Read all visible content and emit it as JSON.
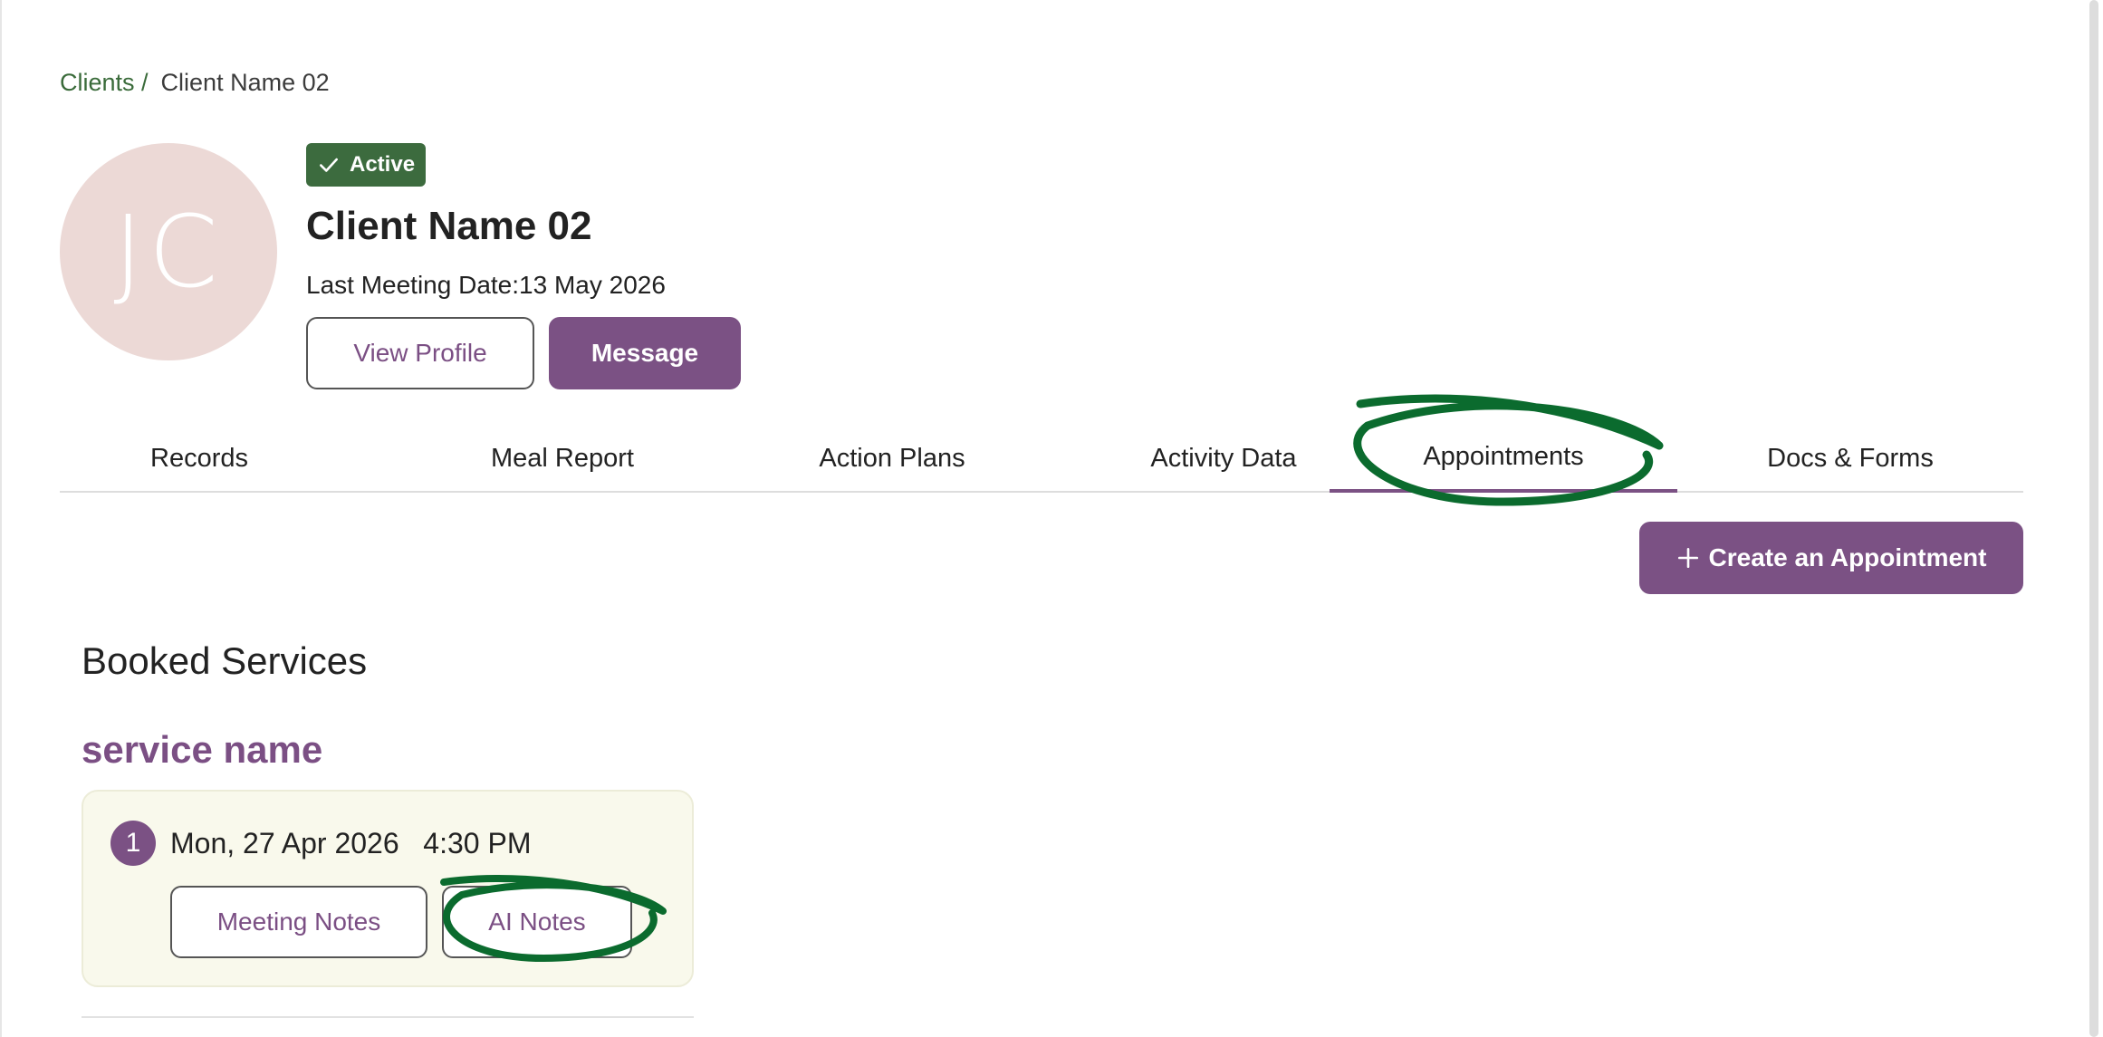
{
  "breadcrumb": {
    "parent": "Clients /",
    "current": "Client Name 02"
  },
  "client": {
    "initials": "JC",
    "status": "Active",
    "name": "Client Name 02",
    "last_meeting": "Last Meeting Date:13 May 2026"
  },
  "actions": {
    "view_profile": "View Profile",
    "message": "Message"
  },
  "tabs": [
    {
      "label": "Records"
    },
    {
      "label": "Meal Report"
    },
    {
      "label": "Action Plans"
    },
    {
      "label": "Activity Data"
    },
    {
      "label": "Appointments",
      "active": true
    },
    {
      "label": "Docs & Forms"
    }
  ],
  "create_button": "Create an Appointment",
  "booked": {
    "heading": "Booked Services",
    "service_name": "service name",
    "appointments": [
      {
        "number": "1",
        "date": "Mon, 27 Apr 2026   4:30 PM",
        "meeting_notes": "Meeting Notes",
        "ai_notes": "AI Notes"
      }
    ]
  },
  "colors": {
    "brand_purple": "#7b5184",
    "active_green": "#3c6b3e",
    "annotation_green": "#0b6b2e"
  },
  "icons": {
    "status_check": "check-icon",
    "create": "plus-icon"
  }
}
